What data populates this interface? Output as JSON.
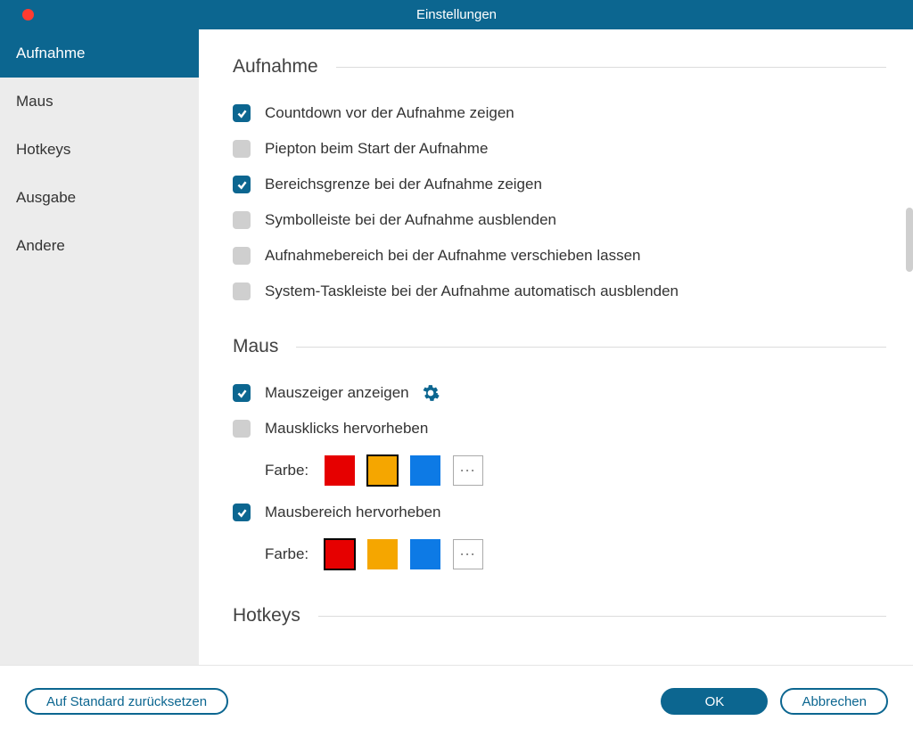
{
  "window": {
    "title": "Einstellungen"
  },
  "sidebar": {
    "items": [
      {
        "label": "Aufnahme",
        "active": true
      },
      {
        "label": "Maus",
        "active": false
      },
      {
        "label": "Hotkeys",
        "active": false
      },
      {
        "label": "Ausgabe",
        "active": false
      },
      {
        "label": "Andere",
        "active": false
      }
    ]
  },
  "sections": {
    "aufnahme": {
      "title": "Aufnahme",
      "options": [
        {
          "label": "Countdown vor der Aufnahme zeigen",
          "checked": true
        },
        {
          "label": "Piepton beim Start der Aufnahme",
          "checked": false
        },
        {
          "label": "Bereichsgrenze bei der Aufnahme zeigen",
          "checked": true
        },
        {
          "label": "Symbolleiste bei der Aufnahme ausblenden",
          "checked": false
        },
        {
          "label": "Aufnahmebereich bei der Aufnahme verschieben lassen",
          "checked": false
        },
        {
          "label": "System-Taskleiste bei der Aufnahme automatisch ausblenden",
          "checked": false
        }
      ]
    },
    "maus": {
      "title": "Maus",
      "show_pointer": {
        "label": "Mauszeiger anzeigen",
        "checked": true
      },
      "highlight_clicks": {
        "label": "Mausklicks hervorheben",
        "checked": false,
        "color_label": "Farbe:",
        "colors": [
          "#e60000",
          "#f5a600",
          "#0d7ae5"
        ],
        "selected_index": 1,
        "more": "⋯"
      },
      "highlight_area": {
        "label": "Mausbereich hervorheben",
        "checked": true,
        "color_label": "Farbe:",
        "colors": [
          "#e60000",
          "#f5a600",
          "#0d7ae5"
        ],
        "selected_index": 0,
        "more": "⋯"
      }
    },
    "hotkeys": {
      "title": "Hotkeys"
    }
  },
  "footer": {
    "reset": "Auf Standard zurücksetzen",
    "ok": "OK",
    "cancel": "Abbrechen"
  }
}
